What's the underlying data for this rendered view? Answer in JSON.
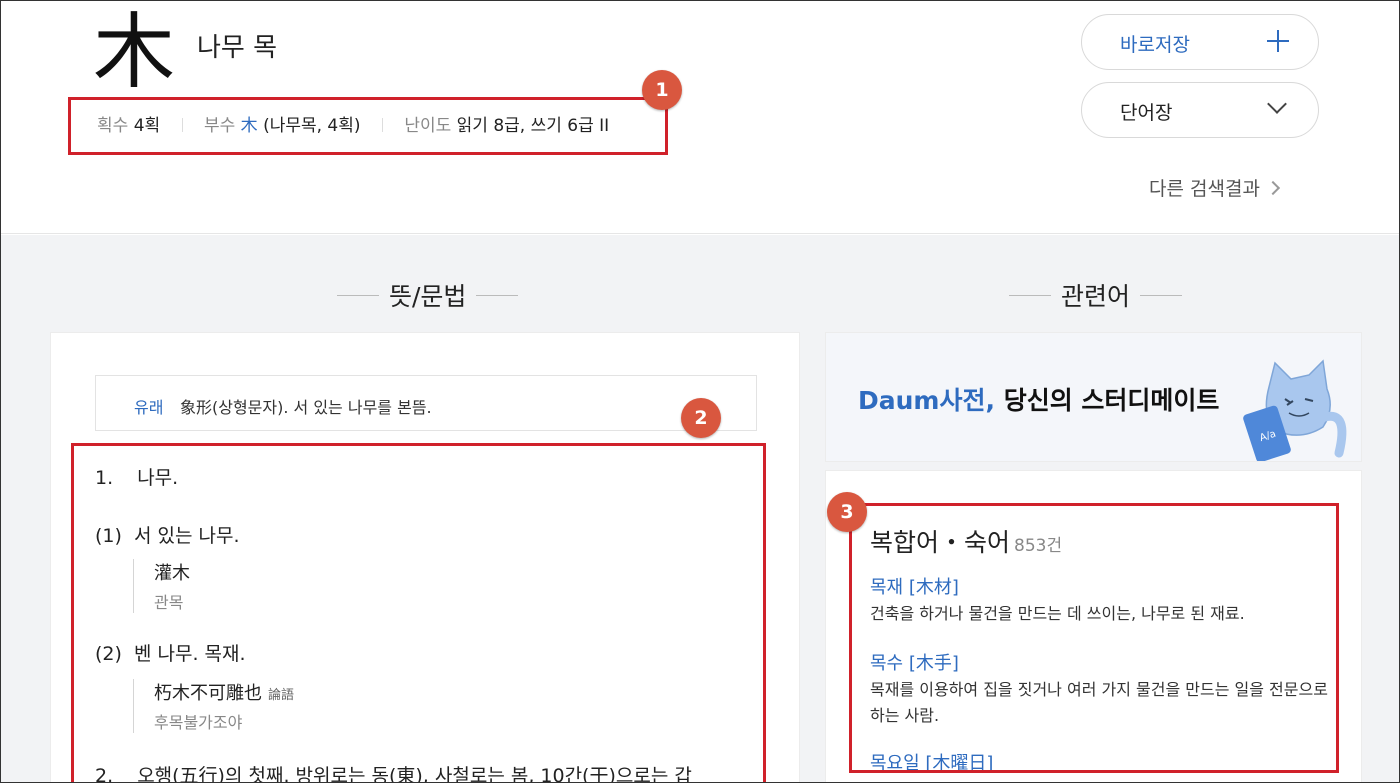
{
  "entry": {
    "hanja": "木",
    "reading": "나무 목",
    "strokes_label": "획수",
    "strokes_value": "4획",
    "radical_label": "부수",
    "radical_char": "木",
    "radical_value": "(나무목, 4획)",
    "difficulty_label": "난이도",
    "difficulty_value": "읽기 8급, 쓰기 6급 II"
  },
  "actions": {
    "save_label": "바로저장",
    "vocab_label": "단어장",
    "other_results": "다른 검색결과"
  },
  "sections": {
    "meaning_title": "뜻/문법",
    "related_title": "관련어"
  },
  "meaning": {
    "origin_label": "유래",
    "origin_text": "象形(상형문자). 서 있는 나무를 본뜸.",
    "items": [
      {
        "num": "1.",
        "text": "나무."
      },
      {
        "num": "(1)",
        "text": "서 있는 나무."
      },
      {
        "num": "(2)",
        "text": "벤 나무. 목재."
      },
      {
        "num": "2.",
        "text": "오행(五行)의 첫째. 방위로는 동(東), 사철로는 봄, 10간(干)으로는 갑"
      }
    ],
    "examples": [
      {
        "hanja": "灌木",
        "source": "",
        "reading": "관목"
      },
      {
        "hanja": "朽木不可雕也",
        "source": "論語",
        "reading": "후목불가조야"
      }
    ]
  },
  "ad": {
    "brand": "Daum사전,",
    "text": "당신의 스터디메이트"
  },
  "related": {
    "heading": "복합어・숙어",
    "count": "853건",
    "words": [
      {
        "word": "목재 [木材]",
        "def": "건축을 하거나 물건을 만드는 데 쓰이는, 나무로 된 재료."
      },
      {
        "word": "목수 [木手]",
        "def": "목재를 이용하여 집을 짓거나 여러 가지 물건을 만드는 일을 전문으로 하는 사람."
      },
      {
        "word": "목요일 [木曜日]",
        "def": ""
      }
    ]
  },
  "badges": [
    "1",
    "2",
    "3"
  ],
  "colors": {
    "accent": "#2e6bbf",
    "highlight": "#d0212a",
    "badge": "#d9573f"
  }
}
